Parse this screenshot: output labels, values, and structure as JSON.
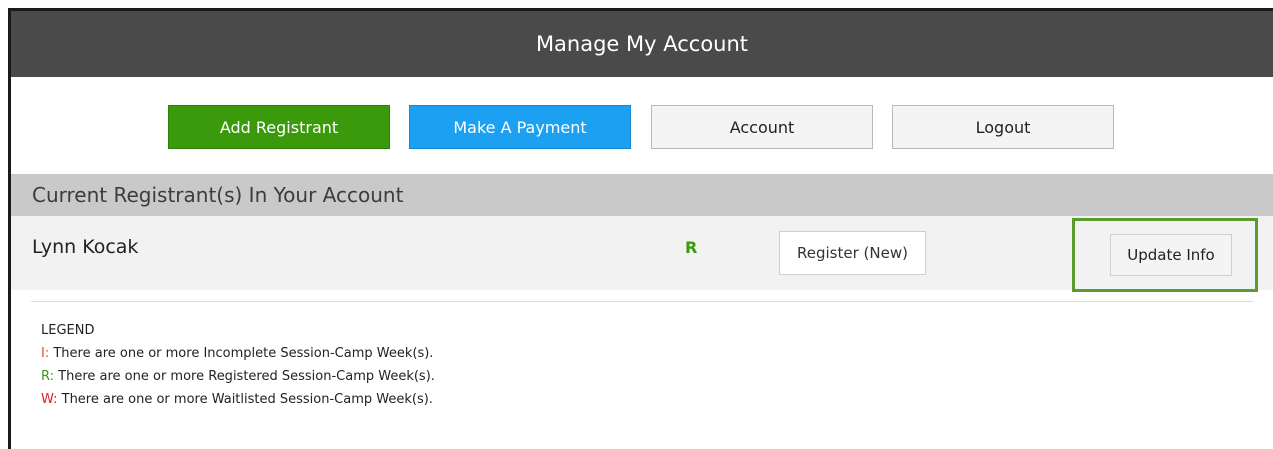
{
  "header": {
    "title": "Manage My Account"
  },
  "actions": {
    "add_registrant": "Add Registrant",
    "make_payment": "Make A Payment",
    "account": "Account",
    "logout": "Logout"
  },
  "registrants_section": {
    "title": "Current Registrant(s) In Your Account",
    "rows": [
      {
        "name": "Lynn Kocak",
        "status_code": "R",
        "register_label": "Register (New)",
        "update_label": "Update Info"
      }
    ]
  },
  "legend": {
    "title": "LEGEND",
    "items": [
      {
        "code": "I:",
        "text": "There are one or more Incomplete Session-Camp Week(s)."
      },
      {
        "code": "R:",
        "text": "There are one or more Registered Session-Camp Week(s)."
      },
      {
        "code": "W:",
        "text": "There are one or more Waitlisted Session-Camp Week(s)."
      }
    ]
  },
  "colors": {
    "header_bg": "#4a4a4a",
    "add_registrant": "#3a9a0c",
    "make_payment": "#1ba0f2",
    "registered_green": "#3a9a0c",
    "incomplete_red": "#e0473c",
    "waitlisted_red": "#e02020",
    "highlight_box": "#5b9a2c"
  }
}
